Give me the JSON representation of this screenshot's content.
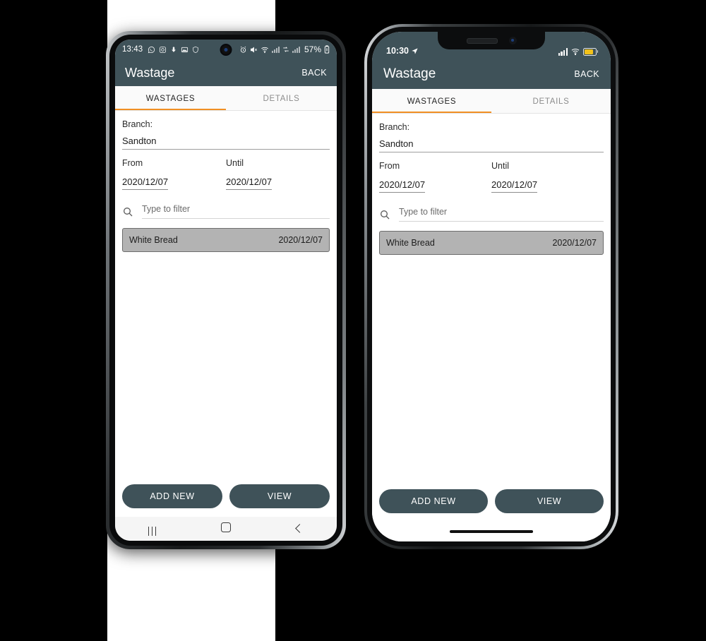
{
  "android": {
    "status": {
      "time": "13:43",
      "left_icons": [
        "whatsapp-icon",
        "instagram-icon",
        "download-icon",
        "gallery-icon",
        "shield-icon"
      ],
      "right_icons": [
        "alarm-icon",
        "mute-icon",
        "wifi-icon",
        "signal-icon",
        "sync-icon",
        "signal-icon"
      ],
      "battery_percent": "57%"
    },
    "appbar": {
      "title": "Wastage",
      "back_label": "BACK"
    },
    "tabs": [
      {
        "label": "WASTAGES",
        "active": true
      },
      {
        "label": "DETAILS",
        "active": false
      }
    ],
    "form": {
      "branch_label": "Branch:",
      "branch_value": "Sandton",
      "from_label": "From",
      "from_value": "2020/12/07",
      "until_label": "Until",
      "until_value": "2020/12/07",
      "filter_placeholder": "Type to filter"
    },
    "list": [
      {
        "name": "White Bread",
        "date": "2020/12/07"
      }
    ],
    "buttons": [
      {
        "label": "ADD NEW"
      },
      {
        "label": "VIEW"
      }
    ],
    "navbar": [
      "recents-icon",
      "home-icon",
      "back-icon"
    ]
  },
  "iphone": {
    "status": {
      "time": "10:30",
      "location_icon": "location-arrow-icon",
      "right_icons": [
        "signal-icon",
        "wifi-icon",
        "battery-icon"
      ]
    },
    "appbar": {
      "title": "Wastage",
      "back_label": "BACK"
    },
    "tabs": [
      {
        "label": "WASTAGES",
        "active": true
      },
      {
        "label": "DETAILS",
        "active": false
      }
    ],
    "form": {
      "branch_label": "Branch:",
      "branch_value": "Sandton",
      "from_label": "From",
      "from_value": "2020/12/07",
      "until_label": "Until",
      "until_value": "2020/12/07",
      "filter_placeholder": "Type to filter"
    },
    "list": [
      {
        "name": "White Bread",
        "date": "2020/12/07"
      }
    ],
    "buttons": [
      {
        "label": "ADD NEW"
      },
      {
        "label": "VIEW"
      }
    ]
  },
  "theme": {
    "header_color": "#3f5259",
    "accent_color": "#f19024",
    "selected_row_color": "#b3b3b3",
    "battery_color": "#f2c21a"
  }
}
